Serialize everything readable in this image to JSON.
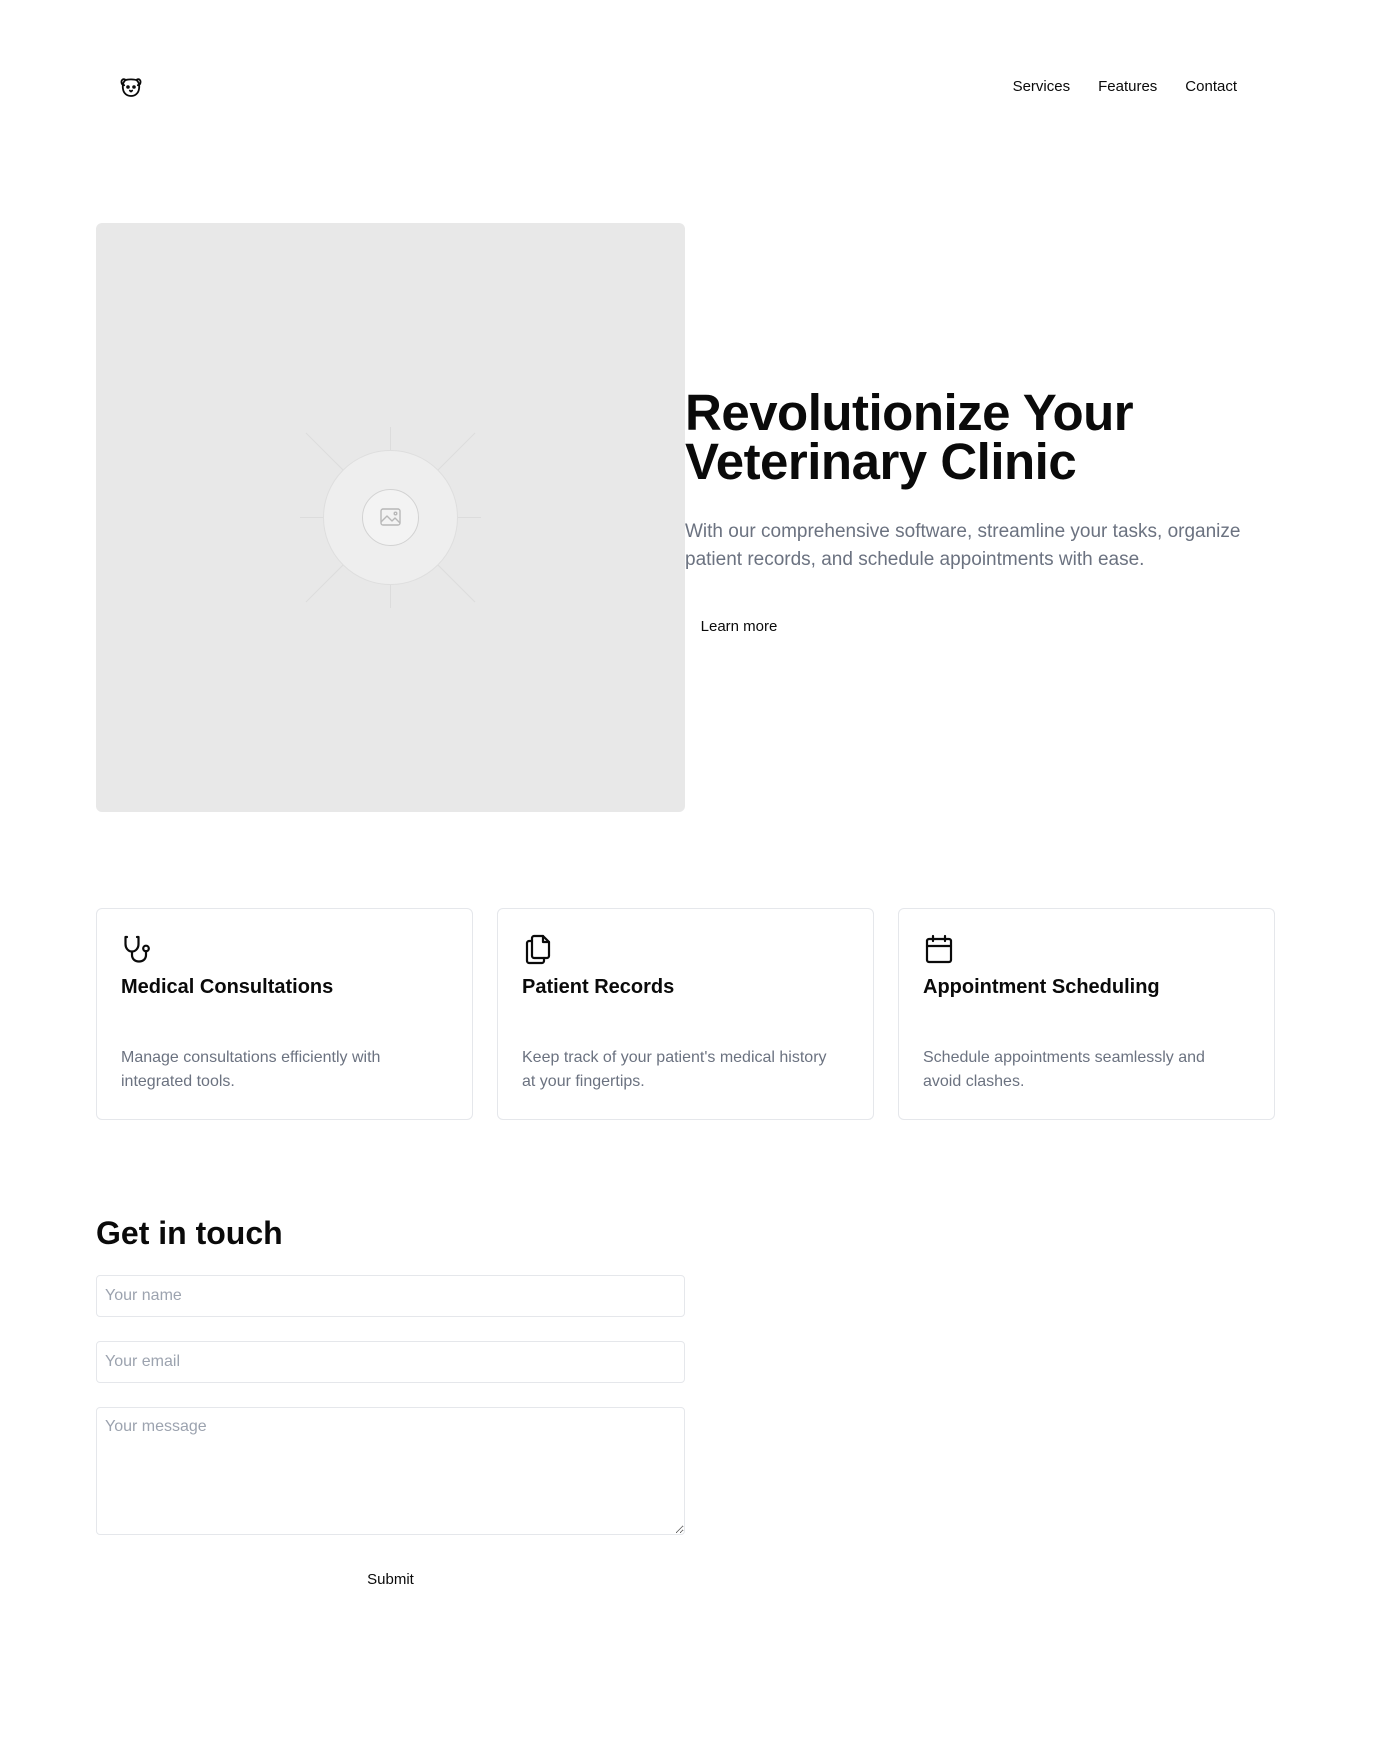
{
  "header": {
    "logo_icon": "dog-face-icon",
    "nav": [
      {
        "label": "Services"
      },
      {
        "label": "Features"
      },
      {
        "label": "Contact"
      }
    ]
  },
  "hero": {
    "image_icon": "image-placeholder-icon",
    "title_line1": "Revolutionize Your",
    "title_line2": "Veterinary Clinic",
    "subtitle": "With our comprehensive software, streamline your tasks, organize patient records, and schedule appointments with ease.",
    "cta_label": "Learn more"
  },
  "features": [
    {
      "icon": "stethoscope-icon",
      "title": "Medical Consultations",
      "description": "Manage consultations efficiently with integrated tools."
    },
    {
      "icon": "documents-icon",
      "title": "Patient Records",
      "description": "Keep track of your patient's medical history at your fingertips."
    },
    {
      "icon": "calendar-icon",
      "title": "Appointment Scheduling",
      "description": "Schedule appointments seamlessly and avoid clashes."
    }
  ],
  "contact": {
    "title": "Get in touch",
    "name_placeholder": "Your name",
    "email_placeholder": "Your email",
    "message_placeholder": "Your message",
    "submit_label": "Submit"
  },
  "colors": {
    "text": "#0a0a0a",
    "muted_text": "#6b7280",
    "placeholder_bg": "#e8e8e8",
    "border": "#e5e7eb"
  }
}
